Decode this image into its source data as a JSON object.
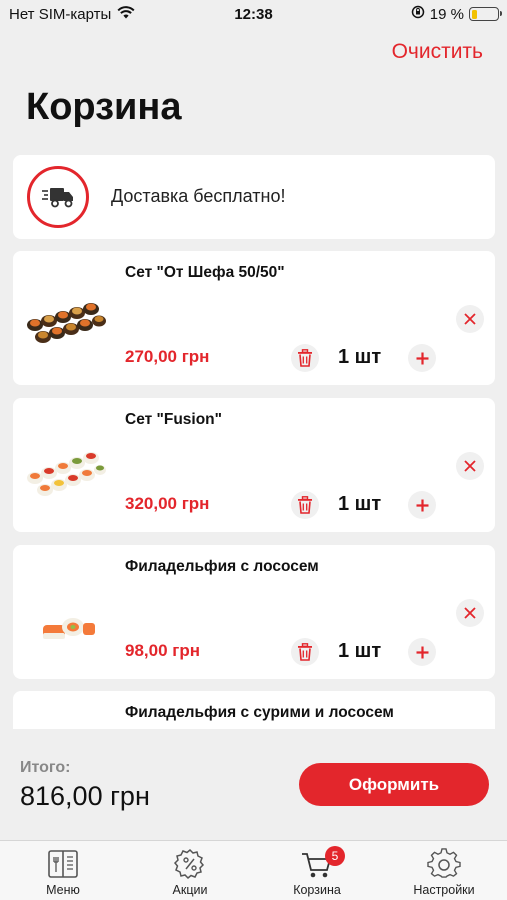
{
  "status_bar": {
    "carrier": "Нет SIM-карты",
    "time": "12:38",
    "battery": "19 %",
    "battery_level": 0.19
  },
  "header": {
    "clear_label": "Очистить",
    "title": "Корзина"
  },
  "delivery": {
    "text": "Доставка бесплатно!"
  },
  "items": [
    {
      "name": "Сет \"От Шефа 50/50\"",
      "price": "270,00 грн",
      "qty": "1 шт"
    },
    {
      "name": "Сет \"Fusion\"",
      "price": "320,00 грн",
      "qty": "1 шт"
    },
    {
      "name": "Филадельфия с лососем",
      "price": "98,00 грн",
      "qty": "1 шт"
    },
    {
      "name": "Филадельфия с сурими и лососем"
    }
  ],
  "total": {
    "label": "Итого:",
    "value": "816,00 грн",
    "checkout_label": "Оформить"
  },
  "tabs": [
    {
      "label": "Меню",
      "icon": "menu-book-icon"
    },
    {
      "label": "Акции",
      "icon": "discount-badge-icon"
    },
    {
      "label": "Корзина",
      "icon": "cart-icon",
      "badge": "5"
    },
    {
      "label": "Настройки",
      "icon": "gear-icon"
    }
  ],
  "colors": {
    "accent": "#e3262c",
    "background": "#efefef",
    "battery": "#f2c100"
  }
}
